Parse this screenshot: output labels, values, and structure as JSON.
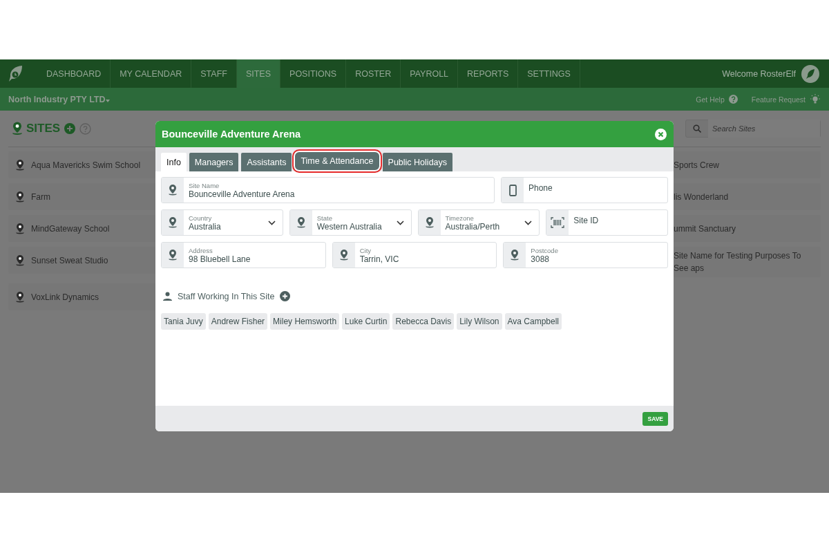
{
  "nav": {
    "items": [
      {
        "label": "DASHBOARD",
        "selected": false
      },
      {
        "label": "MY CALENDAR",
        "selected": false
      },
      {
        "label": "STAFF",
        "selected": false
      },
      {
        "label": "SITES",
        "selected": true
      },
      {
        "label": "POSITIONS",
        "selected": false
      },
      {
        "label": "ROSTER",
        "selected": false
      },
      {
        "label": "PAYROLL",
        "selected": false
      },
      {
        "label": "REPORTS",
        "selected": false
      },
      {
        "label": "SETTINGS",
        "selected": false
      }
    ],
    "welcome": "Welcome RosterElf"
  },
  "subbar": {
    "organisation": "North Industry PTY LTD",
    "links": [
      {
        "label": "Get Help",
        "kind": "help"
      },
      {
        "label": "Feature Request",
        "kind": "idea"
      }
    ]
  },
  "page": {
    "title": "SITES",
    "search": {
      "placeholder": "Search Sites"
    },
    "sites_left": [
      "Aqua Mavericks Swim School",
      "Farm",
      "MindGateway School",
      "Sunset Sweat Studio",
      "VoxLink Dynamics"
    ],
    "sites_right": [
      "Sports Crew",
      "lis Wonderland",
      "ummit Sanctuary",
      "Site Name for Testing Purposes To See aps"
    ]
  },
  "modal": {
    "title": "Bounceville Adventure Arena",
    "tabs": [
      {
        "label": "Info",
        "selected": true,
        "highlighted": false
      },
      {
        "label": "Managers",
        "selected": false,
        "highlighted": false
      },
      {
        "label": "Assistants",
        "selected": false,
        "highlighted": false
      },
      {
        "label": "Time & Attendance",
        "selected": false,
        "highlighted": true
      },
      {
        "label": "Public Holidays",
        "selected": false,
        "highlighted": false
      }
    ],
    "field_rows": [
      [
        {
          "label": "Site Name",
          "value": "Bounceville Adventure Arena",
          "kind": "text"
        },
        {
          "placeholder": "Phone",
          "kind": "phone"
        }
      ],
      [
        {
          "label": "Country",
          "value": "Australia",
          "kind": "select"
        },
        {
          "label": "State",
          "value": "Western Australia",
          "kind": "select"
        },
        {
          "label": "Timezone",
          "value": "Australia/Perth",
          "kind": "select"
        },
        {
          "placeholder": "Site ID",
          "kind": "id"
        }
      ],
      [
        {
          "label": "Address",
          "value": "98 Bluebell Lane",
          "kind": "text"
        },
        {
          "label": "City",
          "value": "Tarrin, VIC",
          "kind": "text"
        },
        {
          "label": "Postcode",
          "value": "3088",
          "kind": "text"
        }
      ]
    ],
    "staff_title": "Staff Working In This Site",
    "staff": [
      "Tania Juvy",
      "Andrew Fisher",
      "Miley Hemsworth",
      "Luke Curtin",
      "Rebecca Davis",
      "Lily Wilson",
      "Ava Campbell"
    ],
    "save": "SAVE"
  }
}
